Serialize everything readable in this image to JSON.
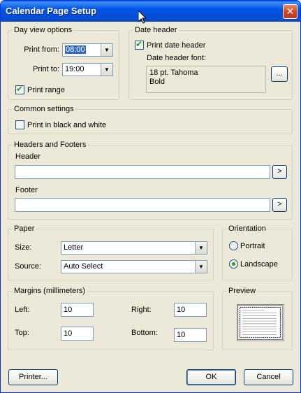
{
  "window": {
    "title": "Calendar Page Setup",
    "close_glyph": "✕"
  },
  "day_view": {
    "legend": "Day view options",
    "print_from_label": "Print from:",
    "print_from_value": "08:00",
    "print_to_label": "Print to:",
    "print_to_value": "19:00",
    "print_range_label": "Print range",
    "print_range_checked": true
  },
  "date_header": {
    "legend": "Date header",
    "print_date_header_label": "Print date header",
    "print_date_header_checked": true,
    "font_label": "Date header font:",
    "font_line1": "18 pt. Tahoma",
    "font_line2": "Bold",
    "font_button": "..."
  },
  "common": {
    "legend": "Common settings",
    "bw_label": "Print in black and white",
    "bw_checked": false
  },
  "headers_footers": {
    "legend": "Headers and Footers",
    "header_label": "Header",
    "header_value": "",
    "header_button": ">",
    "footer_label": "Footer",
    "footer_value": "",
    "footer_button": ">"
  },
  "paper": {
    "legend": "Paper",
    "size_label": "Size:",
    "size_value": "Letter",
    "source_label": "Source:",
    "source_value": "Auto Select"
  },
  "orientation": {
    "legend": "Orientation",
    "portrait_label": "Portrait",
    "landscape_label": "Landscape",
    "selected": "Landscape"
  },
  "margins": {
    "legend": "Margins (millimeters)",
    "left_label": "Left:",
    "left_value": "10",
    "right_label": "Right:",
    "right_value": "10",
    "top_label": "Top:",
    "top_value": "10",
    "bottom_label": "Bottom:",
    "bottom_value": "10"
  },
  "preview": {
    "legend": "Preview"
  },
  "buttons": {
    "printer": "Printer...",
    "ok": "OK",
    "cancel": "Cancel"
  },
  "colors": {
    "titlebar": "#0055e5",
    "dialog_bg": "#ece9d8",
    "check_mark": "#21a121",
    "selection": "#316ac5"
  }
}
